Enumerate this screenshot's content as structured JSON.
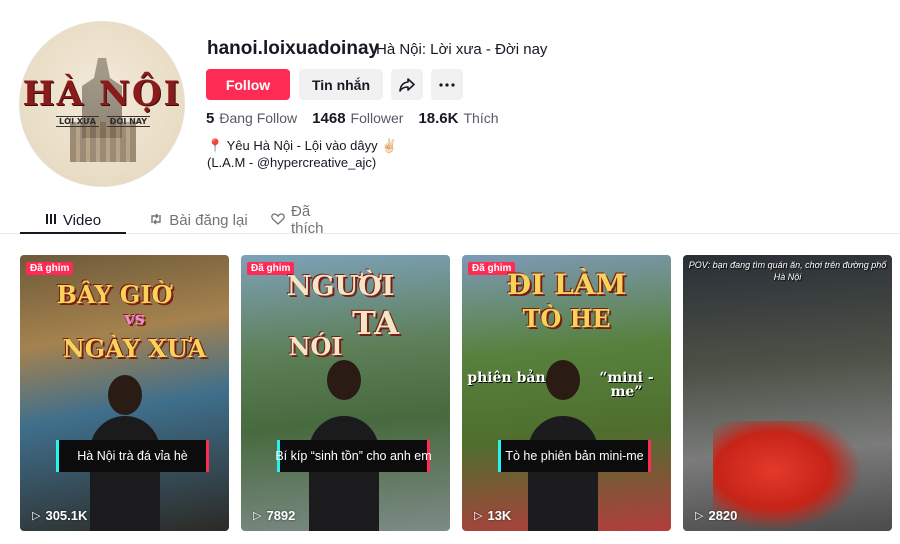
{
  "profile": {
    "avatar_brand": "HÀ NỘI",
    "avatar_sub_left": "LỜI XƯA",
    "avatar_sub_right": "ĐỜI NAY",
    "username": "hanoi.loixuadoinay",
    "nickname": "Hà Nội: Lời xưa - Đời nay",
    "follow_label": "Follow",
    "message_label": "Tin nhắn",
    "share_icon": "share-icon",
    "more_icon": "more-icon"
  },
  "stats": {
    "following_count": "5",
    "following_label": "Đang Follow",
    "followers_count": "1468",
    "followers_label": "Follower",
    "likes_count": "18.6K",
    "likes_label": "Thích"
  },
  "bio": {
    "line1": "Yêu Hà Nội - Lội vào dâyy",
    "line2": "(L.A.M - @hypercreative_ajc)"
  },
  "tabs": [
    {
      "label": "Video",
      "icon": "grid-icon",
      "active": true
    },
    {
      "label": "Bài đăng lại",
      "icon": "repost-icon",
      "active": false
    },
    {
      "label": "Đã thích",
      "icon": "heart-icon",
      "active": false
    }
  ],
  "videos": [
    {
      "pinned": "Đã ghim",
      "title_top": "BÂY GIỜ",
      "title_mid": "vs",
      "title_bottom": "NGÀY XƯA",
      "caption": "Hà Nội trà đá vỉa hè",
      "views": "305.1K"
    },
    {
      "pinned": "Đã ghim",
      "title_top": "NGƯỜI",
      "title_mid": "TA",
      "title_bottom": "NÓI",
      "caption": "Bí kíp “sinh tồn” cho anh em",
      "views": "7892"
    },
    {
      "pinned": "Đã ghim",
      "title_top": "ĐI LÀM",
      "title_mid": "TÒ HE",
      "title_bottom": "phiên bản",
      "title_extra": "“mini - me”",
      "caption": "Tò he phiên bản mini-me",
      "views": "13K"
    },
    {
      "pov": "POV: bạn đang tìm quán ăn, chơi trên đường phố Hà Nội",
      "views": "2820"
    }
  ],
  "colors": {
    "accent": "#fe2c55",
    "text": "#161823",
    "muted": "#555a66"
  }
}
